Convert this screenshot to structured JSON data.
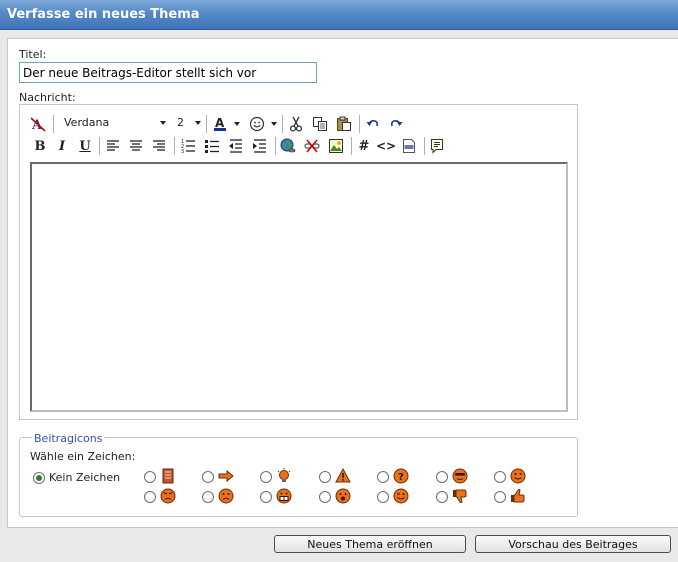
{
  "header": {
    "title": "Verfasse ein neues Thema"
  },
  "form": {
    "title_label": "Titel:",
    "title_value": "Der neue Beitrags-Editor stellt sich vor",
    "message_label": "Nachricht:",
    "message_value": ""
  },
  "toolbar": {
    "font": "Verdana",
    "size": "2",
    "row1_icons": [
      "remove-format-icon",
      "font-color-icon",
      "smiley-icon",
      "cut-icon",
      "copy-icon",
      "paste-icon",
      "undo-icon",
      "redo-icon"
    ],
    "row2_icons": [
      "bold-icon",
      "italic-icon",
      "underline-icon",
      "align-left-icon",
      "align-center-icon",
      "align-right-icon",
      "ordered-list-icon",
      "unordered-list-icon",
      "outdent-icon",
      "indent-icon",
      "insert-link-icon",
      "remove-link-icon",
      "insert-image-icon",
      "code-hash-icon",
      "html-code-icon",
      "php-code-icon",
      "quote-icon"
    ],
    "bold": "B",
    "italic": "I",
    "underline": "U",
    "hash": "#",
    "html": "<>"
  },
  "post_icons": {
    "legend": "Beitragicons",
    "prompt": "Wähle ein Zeichen:",
    "none_label": "Kein Zeichen",
    "selected": "none",
    "icons": [
      "document",
      "arrow-right",
      "lightbulb",
      "warning",
      "question",
      "cool",
      "smile",
      "angry",
      "frown",
      "grin",
      "surprised",
      "wink",
      "thumbs-down",
      "thumbs-up"
    ]
  },
  "buttons": {
    "submit": "Neues Thema eröffnen",
    "preview": "Vorschau des Beitrages"
  },
  "colors": {
    "header": "#5489c8",
    "legend": "#3355a8",
    "smiley": "#e8721c"
  }
}
